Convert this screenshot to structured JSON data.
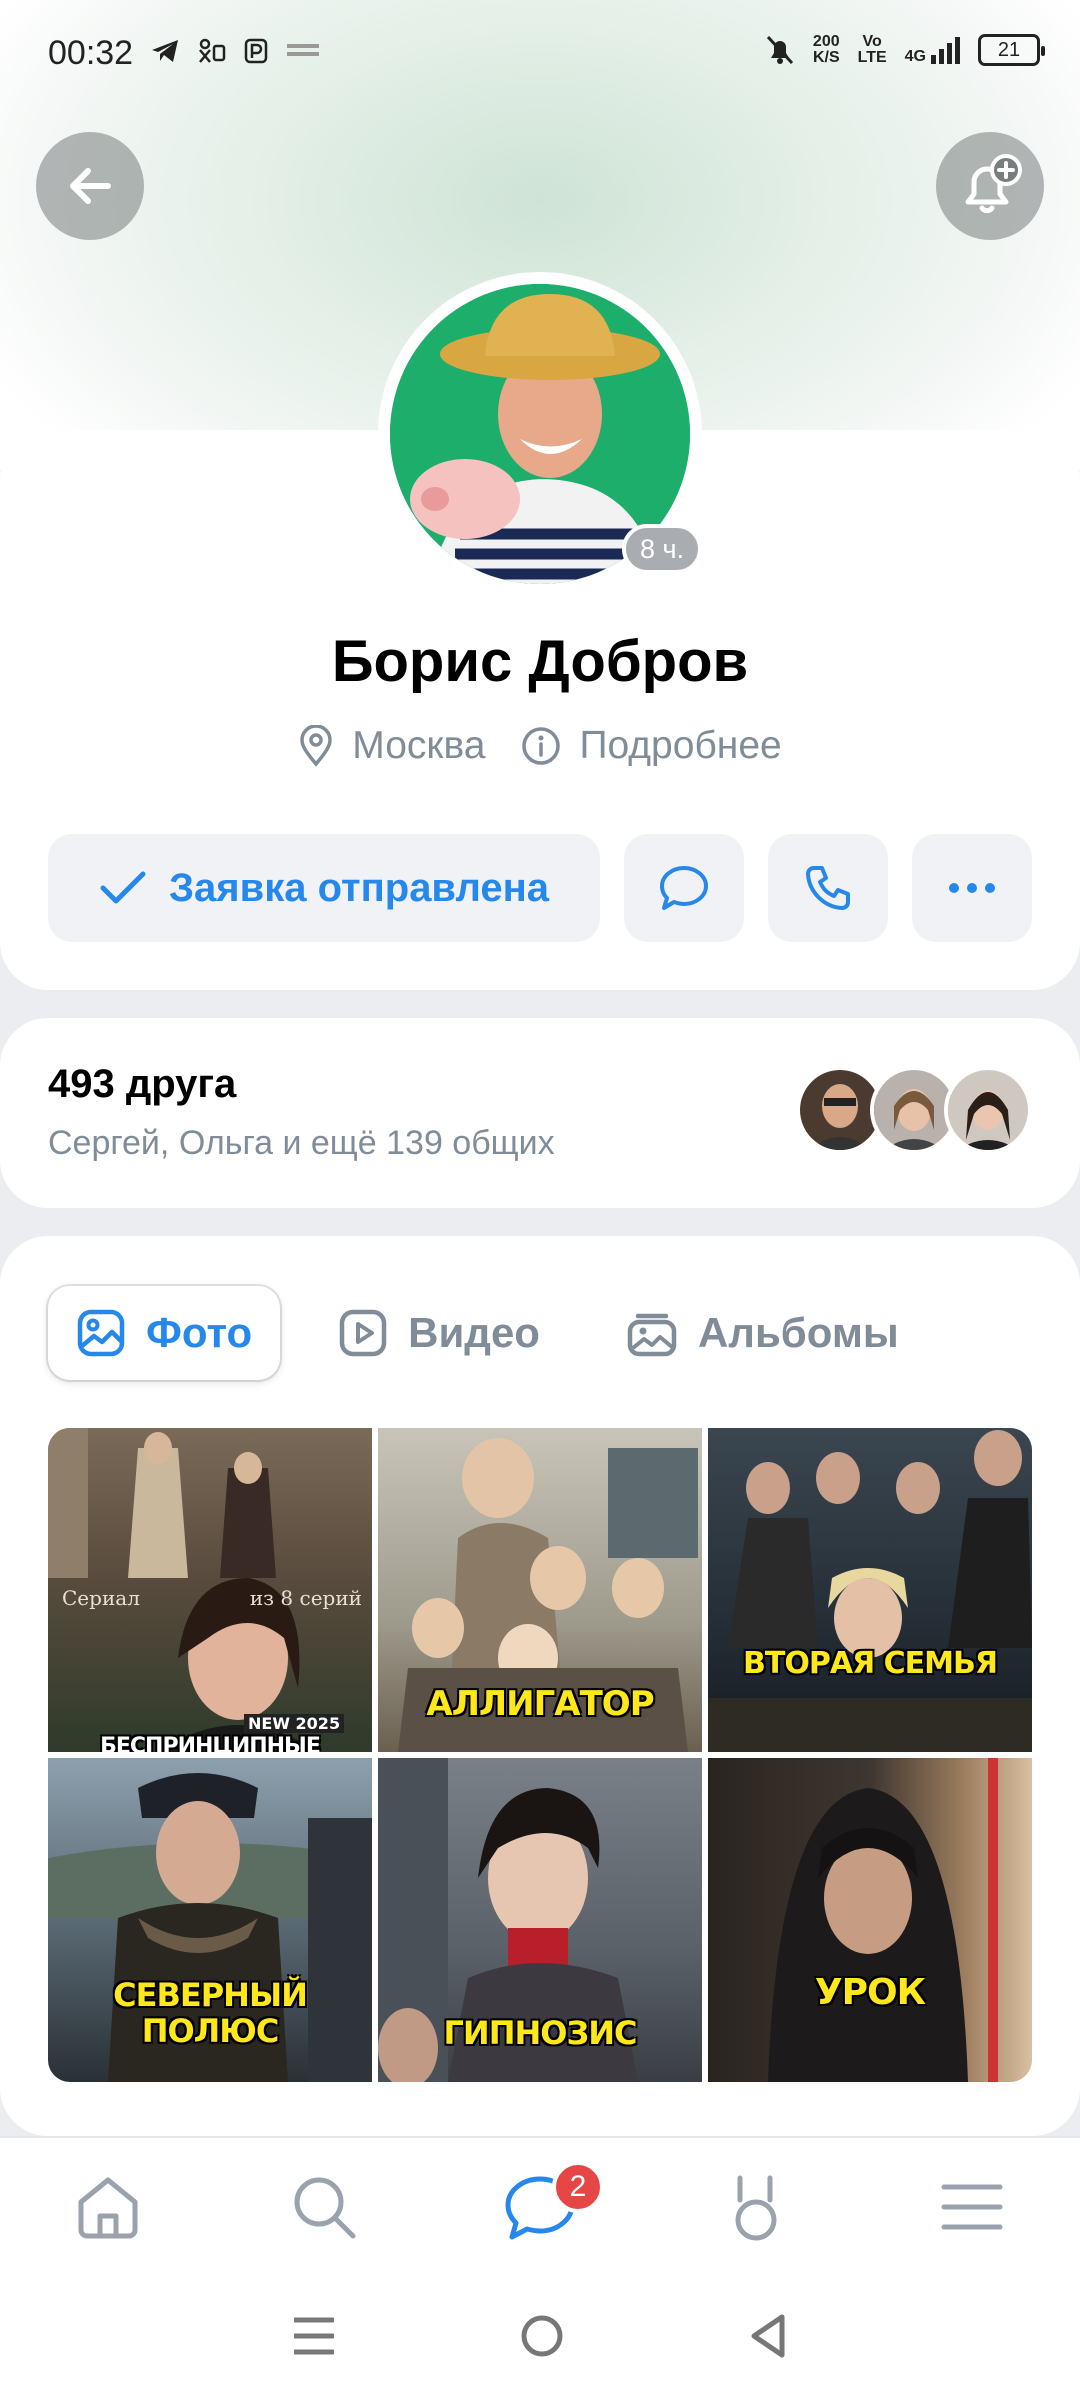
{
  "status_bar": {
    "time": "00:32",
    "speed_value": "200",
    "speed_unit": "K/S",
    "volte_top": "Vo",
    "volte_bottom": "LTE",
    "network": "4G",
    "battery": "21"
  },
  "profile": {
    "name": "Борис Добров",
    "last_seen": "8 ч.",
    "city": "Москва",
    "details_label": "Подробнее"
  },
  "actions": {
    "request_label": "Заявка отправлена"
  },
  "friends": {
    "count_label": "493 друга",
    "mutual_label": "Сергей, Ольга и ещё 139 общих"
  },
  "media_tabs": [
    {
      "label": "Фото"
    },
    {
      "label": "Видео"
    },
    {
      "label": "Альбомы"
    }
  ],
  "photos": [
    {
      "caption": "БЕСПРИНЦИПНЫЕ",
      "small_left": "Сериал",
      "small_right": "из 8 серий",
      "tag": "NEW 2025"
    },
    {
      "caption": "АЛЛИГАТОР"
    },
    {
      "caption": "ВТОРАЯ СЕМЬЯ"
    },
    {
      "caption": "СЕВЕРНЫЙ",
      "caption2": "ПОЛЮС"
    },
    {
      "caption": "ГИПНОЗИС"
    },
    {
      "caption": "УРОК"
    }
  ],
  "bottom_nav": {
    "messages_badge": "2"
  },
  "colors": {
    "accent": "#2688eb",
    "secondary_text": "#818c99",
    "badge": "#e64646"
  }
}
